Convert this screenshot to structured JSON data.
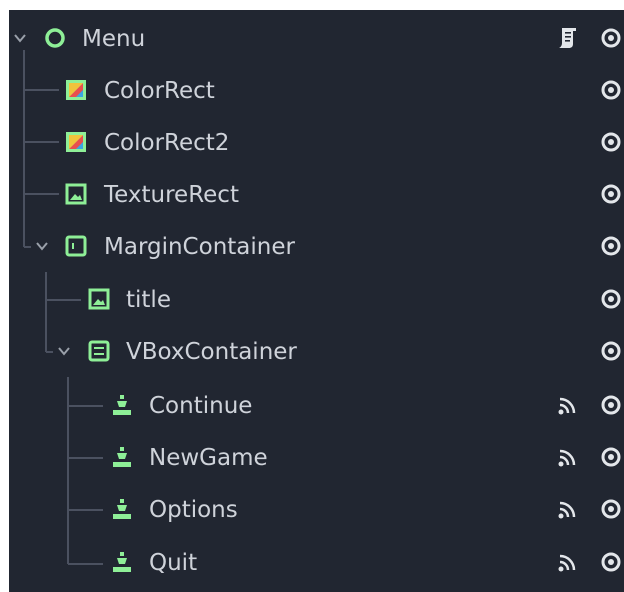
{
  "scene_tree": {
    "colors": {
      "background": "#212631",
      "label": "#cfd3da",
      "node_icon": "#8eef97",
      "control_icon_frame": "#2f9e55",
      "guide": "#4b5160",
      "eye": "#e3e6ea"
    },
    "nodes": [
      {
        "label": "Menu",
        "icon": "node-circle-icon",
        "has_script": true,
        "has_signals": false,
        "visible": true
      },
      {
        "label": "ColorRect",
        "icon": "color-rect-icon",
        "has_script": false,
        "has_signals": false,
        "visible": true
      },
      {
        "label": "ColorRect2",
        "icon": "color-rect-icon",
        "has_script": false,
        "has_signals": false,
        "visible": true
      },
      {
        "label": "TextureRect",
        "icon": "texture-rect-icon",
        "has_script": false,
        "has_signals": false,
        "visible": true
      },
      {
        "label": "MarginContainer",
        "icon": "margin-container-icon",
        "has_script": false,
        "has_signals": false,
        "visible": true
      },
      {
        "label": "title",
        "icon": "texture-rect-icon",
        "has_script": false,
        "has_signals": false,
        "visible": true
      },
      {
        "label": "VBoxContainer",
        "icon": "vbox-container-icon",
        "has_script": false,
        "has_signals": false,
        "visible": true
      },
      {
        "label": "Continue",
        "icon": "button-icon",
        "has_script": false,
        "has_signals": true,
        "visible": true
      },
      {
        "label": "NewGame",
        "icon": "button-icon",
        "has_script": false,
        "has_signals": true,
        "visible": true
      },
      {
        "label": "Options",
        "icon": "button-icon",
        "has_script": false,
        "has_signals": true,
        "visible": true
      },
      {
        "label": "Quit",
        "icon": "button-icon",
        "has_script": false,
        "has_signals": true,
        "visible": true
      }
    ]
  }
}
